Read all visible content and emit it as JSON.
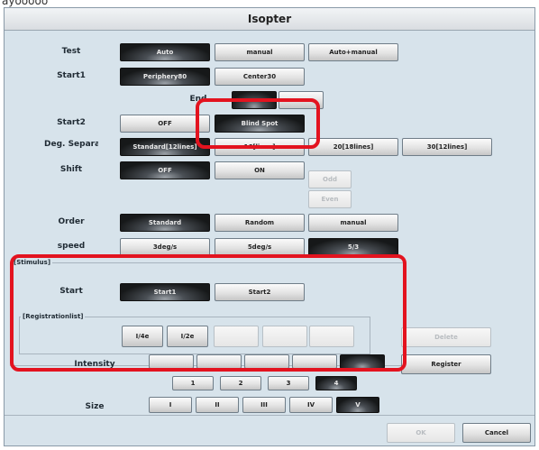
{
  "top_fragment": "ayooooo",
  "window": {
    "title": "Isopter"
  },
  "rows": {
    "test": {
      "label": "Test",
      "options": [
        "Auto",
        "manual",
        "Auto+manual"
      ],
      "selected": "Auto"
    },
    "start1": {
      "label": "Start1",
      "options": [
        "Periphery80",
        "Center30"
      ],
      "selected": "Periphery80"
    },
    "end": {
      "label": "End"
    },
    "start2": {
      "label": "Start2",
      "options": [
        "OFF",
        "Blind Spot"
      ],
      "selected": "Blind Spot"
    },
    "deg": {
      "label": "Deg. Separation",
      "options": [
        "Standard[12lines]",
        "16[lines]",
        "20[18lines]",
        "30[12lines]"
      ],
      "selected": "Standard[12lines]"
    },
    "shift": {
      "label": "Shift",
      "options": [
        "OFF",
        "ON"
      ],
      "selected": "OFF",
      "sub_options": [
        "Odd",
        "Even"
      ]
    },
    "order": {
      "label": "Order",
      "options": [
        "Standard",
        "Random",
        "manual"
      ],
      "selected": "Standard"
    },
    "speed": {
      "label": "speed",
      "options": [
        "3deg/s",
        "5deg/s",
        "5/3"
      ],
      "selected": "5/3"
    }
  },
  "stimulus": {
    "group_label": "[Stimulus]",
    "start_label": "Start",
    "start_options": [
      "Start1",
      "Start2"
    ],
    "start_selected": "Start1",
    "registration": {
      "group_label": "[Registrationlist]",
      "items": [
        "I/4e",
        "I/2e",
        "",
        "",
        ""
      ]
    }
  },
  "intensity": {
    "label": "Intensity",
    "numbers": [
      "1",
      "2",
      "3",
      "4"
    ],
    "selected_number": "4"
  },
  "size": {
    "label": "Size",
    "options": [
      "I",
      "II",
      "III",
      "IV",
      "V"
    ],
    "selected": "V"
  },
  "side_buttons": {
    "delete": "Delete",
    "register": "Register"
  },
  "footer": {
    "ok": "OK",
    "cancel": "Cancel"
  },
  "annotation_color": "#e3131f"
}
